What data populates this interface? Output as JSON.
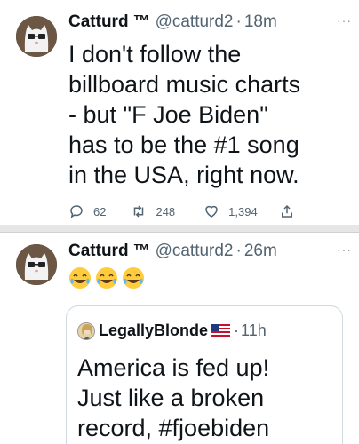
{
  "tweets": [
    {
      "display_name": "Catturd",
      "tm": "™",
      "handle": "@catturd2",
      "dot": "·",
      "time": "18m",
      "more": "···",
      "text": "I don't follow the billboard music charts - but \"F Joe Biden\" has to be the #1 song in the USA, right now.",
      "text_lines": [
        "I don't follow the",
        "billboard music charts",
        "- but \"F Joe Biden\"",
        "has to be the #1 song",
        "in the USA, right now."
      ],
      "replies": "62",
      "retweets": "248",
      "likes": "1,394"
    },
    {
      "display_name": "Catturd",
      "tm": "™",
      "handle": "@catturd2",
      "dot": "·",
      "time": "26m",
      "more": "···",
      "emojis": [
        "😂",
        "😂",
        "😂"
      ],
      "quoted": {
        "display_name": "LegallyBlonde",
        "flag": "us-flag",
        "dot": "·",
        "time": "11h",
        "text_lines": [
          "America is fed up!",
          "Just like a broken",
          "record, #fjoebiden"
        ]
      }
    }
  ],
  "icons": {
    "reply": "reply-icon",
    "retweet": "retweet-icon",
    "like": "like-icon",
    "share": "share-icon"
  },
  "colors": {
    "text": "#0f1419",
    "secondary": "#536471",
    "border": "#cfd9de"
  }
}
